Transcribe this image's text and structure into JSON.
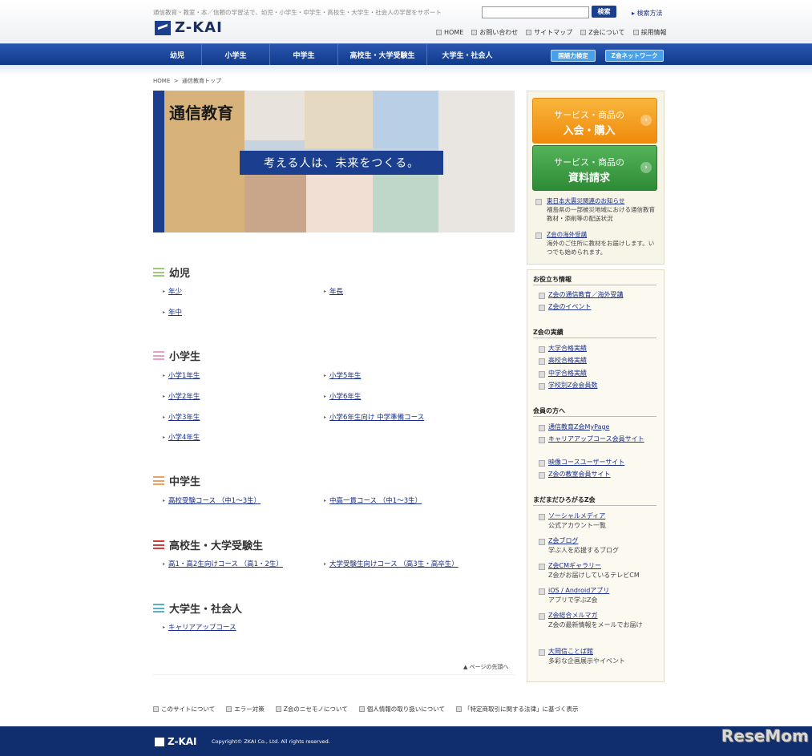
{
  "header": {
    "tagline": "通信教育・教室・本／信頼の学習法で、幼児・小学生・中学生・高校生・大学生・社会人の学習をサポート",
    "logo_text": "Z-KAI",
    "search_button": "検索",
    "search_help": "検索方法",
    "util_nav": [
      "HOME",
      "お問い合わせ",
      "サイトマップ",
      "Z会について",
      "採用情報"
    ]
  },
  "global_nav": {
    "items": [
      "幼児",
      "小学生",
      "中学生",
      "高校生・大学受験生",
      "大学生・社会人"
    ],
    "pills": [
      "国語力検定",
      "Z会ネットワーク"
    ]
  },
  "breadcrumb": {
    "home": "HOME",
    "sep": ">",
    "current": "通信教育トップ"
  },
  "hero": {
    "title": "通信教育",
    "slogan": "考える人は、未来をつくる。"
  },
  "sections": [
    {
      "title": "幼児",
      "color": "#9ccc7a",
      "links": [
        "年少",
        "年長",
        "年中"
      ]
    },
    {
      "title": "小学生",
      "color": "#e9a0c8",
      "links": [
        "小学1年生",
        "小学5年生",
        "小学2年生",
        "小学6年生",
        "小学3年生",
        "小学6年生向け 中学準備コース",
        "小学4年生"
      ]
    },
    {
      "title": "中学生",
      "color": "#f0a060",
      "links": [
        "高校受験コース （中1〜3生）",
        "中高一貫コース （中1〜3生）"
      ]
    },
    {
      "title": "高校生・大学受験生",
      "color": "#d63a3a",
      "links": [
        "高1・高2生向けコース （高1・2生）",
        "大学受験生向けコース （高3生・高卒生）"
      ]
    },
    {
      "title": "大学生・社会人",
      "color": "#5bb0c0",
      "links": [
        "キャリアアップコース"
      ]
    }
  ],
  "page_top": "ページの先頭へ",
  "sidebar": {
    "cta_join": {
      "line1": "サービス・商品の",
      "line2": "入会・購入"
    },
    "cta_doc": {
      "line1": "サービス・商品の",
      "line2": "資料請求"
    },
    "news": [
      {
        "title": "東日本大震災関連のお知らせ",
        "desc": "福島県の一部被災地域における通信教育教材・添削等の配送状況"
      },
      {
        "title": "Z会の海外受講",
        "desc": "海外のご住所に教材をお届けします。いつでも始められます。"
      }
    ],
    "useful": {
      "heading": "お役立ち情報",
      "links": [
        "Z会の通信教育／海外受講",
        "Z会のイベント"
      ]
    },
    "results": {
      "heading": "Z会の実績",
      "links": [
        "大学合格実績",
        "高校合格実績",
        "中学合格実績",
        "学校別Z会会員数"
      ]
    },
    "members": {
      "heading": "会員の方へ",
      "links": [
        "通信教育Z会MyPage",
        "キャリアアップコース会員サイト",
        "映像コースユーザーサイト",
        "Z会の教室会員サイト"
      ]
    },
    "more": {
      "heading": "まだまだひろがるZ会",
      "items": [
        {
          "title": "ソーシャルメディア",
          "desc": "公式アカウント一覧"
        },
        {
          "title": "Z会ブログ",
          "desc": "学ぶ人を応援するブログ"
        },
        {
          "title": "Z会CMギャラリー",
          "desc": "Z会がお届けしているテレビCM"
        },
        {
          "title": "iOS / Androidアプリ",
          "desc": "アプリで学ぶZ会"
        },
        {
          "title": "Z会総合メルマガ",
          "desc": "Z会の最新情報をメールでお届け"
        },
        {
          "title": "大岡信ことば館",
          "desc": "多彩な企画展示やイベント"
        }
      ]
    }
  },
  "footer": {
    "links": [
      "このサイトについて",
      "エラー対策",
      "Z会のニセモノについて",
      "個人情報の取り扱いについて",
      "「特定商取引に関する法律」に基づく表示"
    ],
    "copyright": "Copyright© ZKAI Co., Ltd. All rights reserved.",
    "watermark": "ReseMom"
  }
}
